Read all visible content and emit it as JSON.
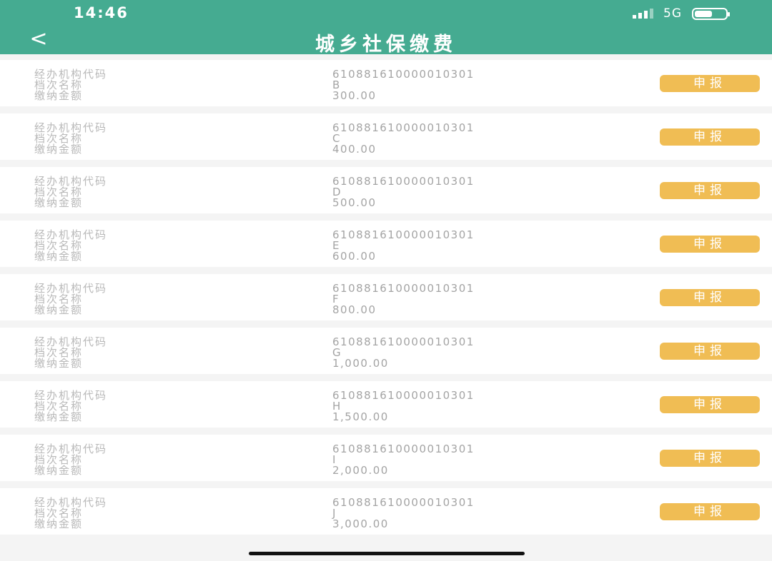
{
  "status_bar": {
    "time": "14:46",
    "network": "5G",
    "battery_level": 0.6
  },
  "header": {
    "back_label": "<",
    "title": "城乡社保缴费"
  },
  "labels": {
    "agency_code": "经办机构代码",
    "grade_name": "档次名称",
    "amount": "缴纳金额"
  },
  "declare_label": "申报",
  "items": [
    {
      "agency_code": "610881610000010301",
      "grade": "B",
      "amount": "300.00"
    },
    {
      "agency_code": "610881610000010301",
      "grade": "C",
      "amount": "400.00"
    },
    {
      "agency_code": "610881610000010301",
      "grade": "D",
      "amount": "500.00"
    },
    {
      "agency_code": "610881610000010301",
      "grade": "E",
      "amount": "600.00"
    },
    {
      "agency_code": "610881610000010301",
      "grade": "F",
      "amount": "800.00"
    },
    {
      "agency_code": "610881610000010301",
      "grade": "G",
      "amount": "1,000.00"
    },
    {
      "agency_code": "610881610000010301",
      "grade": "H",
      "amount": "1,500.00"
    },
    {
      "agency_code": "610881610000010301",
      "grade": "I",
      "amount": "2,000.00"
    },
    {
      "agency_code": "610881610000010301",
      "grade": "J",
      "amount": "3,000.00"
    }
  ],
  "colors": {
    "header": "#45ab91",
    "button": "#f0bd54",
    "label_text": "#b9b9b9",
    "value_text": "#a4a4a4"
  }
}
